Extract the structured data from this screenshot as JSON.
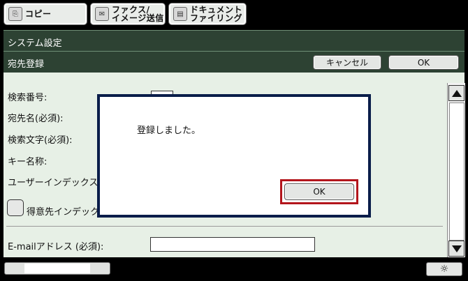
{
  "tabs": [
    {
      "label": "コピー",
      "icon": "copy-icon"
    },
    {
      "label": "ファクス/\nイメージ送信",
      "icon": "fax-icon"
    },
    {
      "label": "ドキュメント\nファイリング",
      "icon": "document-filing-icon"
    }
  ],
  "header": {
    "system_title": "システム設定",
    "section_title": "宛先登録",
    "cancel_label": "キャンセル",
    "ok_label": "OK"
  },
  "form": {
    "search_number": "検索番号:",
    "destination_name": "宛先名(必須):",
    "search_text": "検索文字(必須):",
    "key_name": "キー名称:",
    "user_index": "ユーザーインデックス",
    "frequent_index": "得意先インデック",
    "email_label": "E-mailアドレス (必須):",
    "email_value": ""
  },
  "dialog": {
    "message": "登録しました。",
    "ok_label": "OK"
  },
  "bottom": {
    "brightness_icon": "sun-icon"
  },
  "colors": {
    "header_bg": "#2d4233",
    "panel_bg": "#e7f0e6",
    "dialog_border": "#0a1d4a",
    "highlight": "#b3151c"
  }
}
